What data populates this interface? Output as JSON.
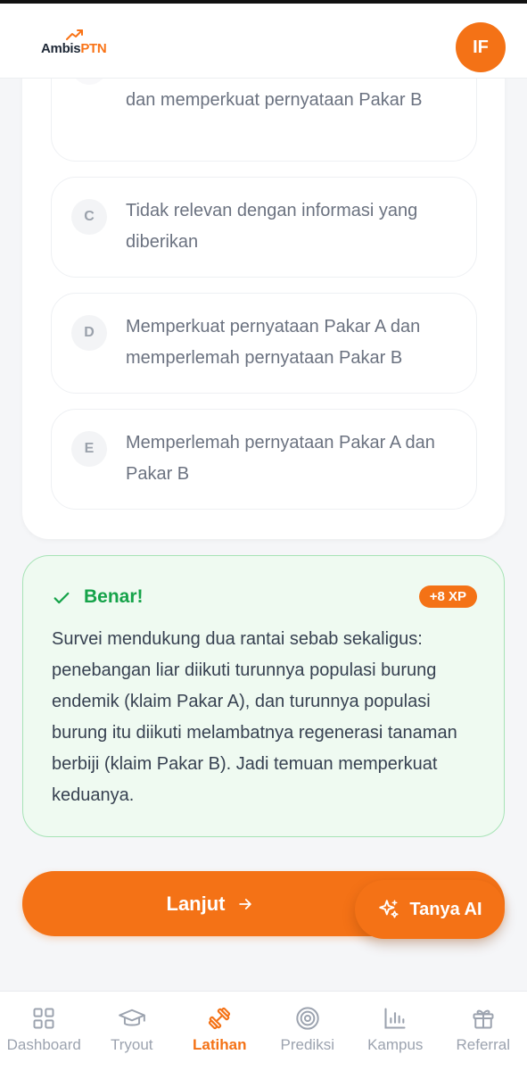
{
  "header": {
    "logo_part1": "Ambis",
    "logo_part2": "PTN",
    "avatar_initials": "IF"
  },
  "options": [
    {
      "letter": "",
      "text": "dan memperkuat pernyataan Pakar B"
    },
    {
      "letter": "C",
      "text": "Tidak relevan dengan informasi yang diberikan"
    },
    {
      "letter": "D",
      "text": "Memperkuat pernyataan Pakar A dan memperlemah pernyataan Pakar B"
    },
    {
      "letter": "E",
      "text": "Memperlemah pernyataan Pakar A dan Pakar B"
    }
  ],
  "feedback": {
    "title": "Benar!",
    "xp": "+8 XP",
    "explanation": "Survei mendukung dua rantai sebab sekaligus: penebangan liar diikuti turunnya populasi burung endemik (klaim Pakar A), dan turunnya populasi burung itu diikuti melambatnya regenerasi tanaman berbiji (klaim Pakar B). Jadi temuan memperkuat keduanya."
  },
  "actions": {
    "next_label": "Lanjut",
    "ask_ai_label": "Tanya AI"
  },
  "nav": [
    {
      "label": "Dashboard",
      "icon": "grid-icon"
    },
    {
      "label": "Tryout",
      "icon": "graduation-cap-icon"
    },
    {
      "label": "Latihan",
      "icon": "dumbbell-icon"
    },
    {
      "label": "Prediksi",
      "icon": "target-icon"
    },
    {
      "label": "Kampus",
      "icon": "bar-chart-icon"
    },
    {
      "label": "Referral",
      "icon": "gift-icon"
    }
  ],
  "colors": {
    "accent": "#f47216",
    "success": "#16a34a",
    "success_bg": "#effaf1"
  }
}
